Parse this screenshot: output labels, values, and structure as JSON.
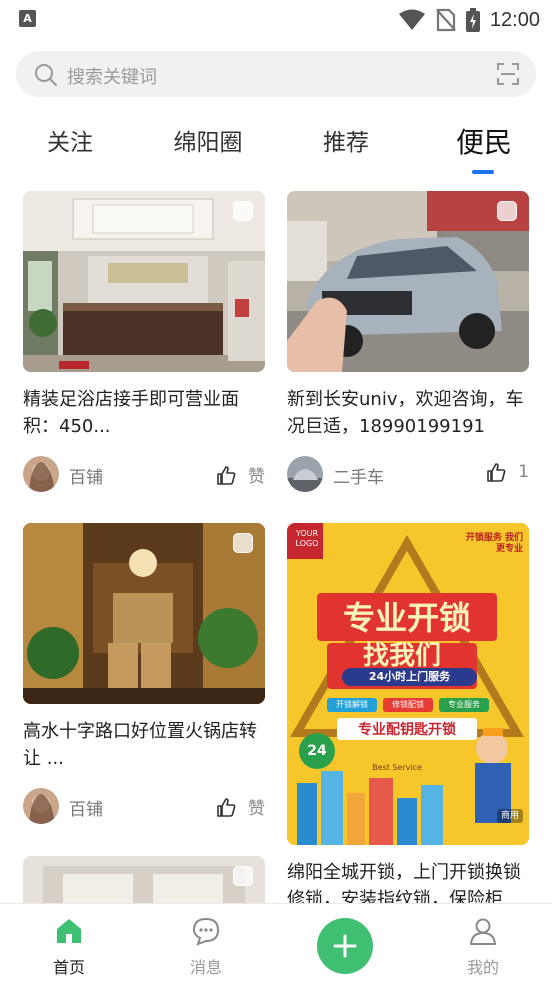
{
  "status_bar": {
    "left_icon": "A",
    "time": "12:00",
    "icons": [
      "wifi-icon",
      "no-sim-icon",
      "battery-charging-icon"
    ]
  },
  "search": {
    "placeholder": "搜索关键词",
    "icon": "search-icon",
    "scan_icon": "scan-icon"
  },
  "tabs": [
    {
      "label": "关注",
      "active": false
    },
    {
      "label": "绵阳圈",
      "active": false
    },
    {
      "label": "推荐",
      "active": false
    },
    {
      "label": "便民",
      "active": true
    }
  ],
  "accent_color": "#1a73e8",
  "brand_green": "#3ebf72",
  "feed": [
    {
      "title": "精装足浴店接手即可营业面积：450...",
      "author": "百铺",
      "likes": "赞",
      "image": "spa-shop-interior"
    },
    {
      "title": "新到长安univ，欢迎咨询，车况巨适，18990199191",
      "author": "二手车",
      "likes": "1",
      "image": "silver-car"
    },
    {
      "title": "高水十字路口好位置火锅店转让 ...",
      "author": "百铺",
      "likes": "赞",
      "image": "restaurant-interior"
    },
    {
      "title": "绵阳全城开锁，上门开锁换锁修锁，安装指纹锁，保险柜",
      "author": "",
      "likes": "",
      "image": "locksmith-poster"
    },
    {
      "title": "",
      "author": "",
      "likes": "",
      "image": "interior-room"
    }
  ],
  "poster": {
    "logo": "YOUR LOGO",
    "corner_tag": "开锁服务 我们更专业",
    "headline_1": "专业开锁",
    "headline_2": "找我们",
    "banner": "24小时上门服务",
    "chips": [
      "开锁解锁",
      "修锁配锁",
      "专业服务"
    ],
    "subhead": "专业配钥匙开锁",
    "badge": "24",
    "service_en": "Best Service",
    "tag": "商用"
  },
  "bottom_nav": [
    {
      "label": "首页",
      "icon": "home-icon",
      "active": true
    },
    {
      "label": "消息",
      "icon": "message-icon",
      "active": false
    },
    {
      "label": "",
      "icon": "plus-icon",
      "active": false
    },
    {
      "label": "我的",
      "icon": "profile-icon",
      "active": false
    }
  ]
}
